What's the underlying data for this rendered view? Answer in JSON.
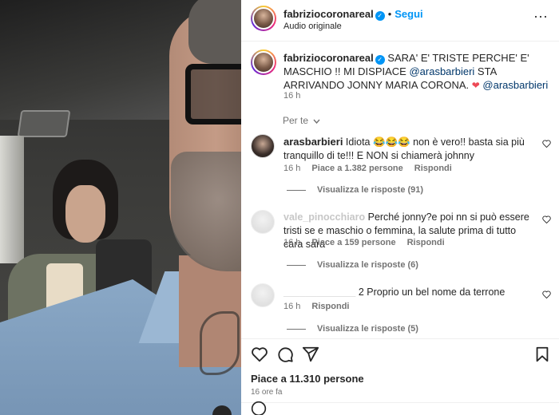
{
  "post": {
    "author": "fabriziocoronareal",
    "follow_label": "Segui",
    "separator": "•",
    "audio": "Audio originale",
    "more_glyph": "···"
  },
  "caption": {
    "username": "fabriziocoronareal",
    "text_part1": "SARA' E' TRISTE PERCHE' E' MASCHIO !! MI DISPIACE ",
    "mention1": "@arasbarbieri",
    "text_part2": " STA ARRIVANDO JONNY MARIA CORONA. ",
    "heart": "❤",
    "mention2": "@arasbarbieri",
    "time": "16 h"
  },
  "translate_label": "Per te",
  "comments": [
    {
      "username": "arasbarbieri",
      "text": "Idiota 😂😂😂 non è vero!! basta sia più tranquillo di te!!! E NON si chiamerà johnny",
      "time": "16 h",
      "likes": "Piace a 1.382 persone",
      "reply": "Rispondi",
      "replies_label": "Visualizza le risposte (91)"
    },
    {
      "username": "vale_pinocchiaro",
      "text": "Perché jonny?e poi nn si può essere tristi se e maschio o femmina, la salute prima di tutto cara sara",
      "time": "16 h",
      "likes": "Piace a 159 persone",
      "reply": "Rispondi",
      "replies_label": "Visualizza le risposte (6)"
    },
    {
      "username": "_____________",
      "text": "Proprio un bel nome da terrone",
      "prefix": "2",
      "time": "16 h",
      "reply": "Rispondi",
      "replies_label": "Visualizza le risposte (5)"
    }
  ],
  "footer": {
    "likes": "Piace a 11.310 persone",
    "ago": "16 ore fa"
  }
}
